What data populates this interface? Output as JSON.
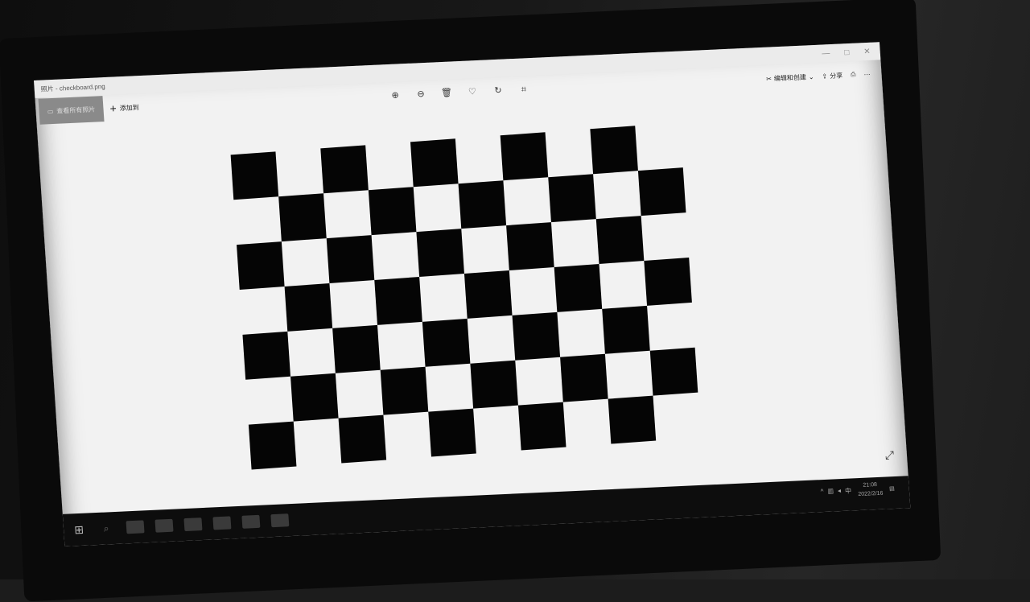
{
  "window": {
    "title": "照片 - checkboard.png"
  },
  "toolbar": {
    "album_label": "查看所有照片",
    "add_label": "添加到",
    "edit_label": "编辑和创建",
    "share_label": "分享",
    "center_tools": [
      "zoom-in-icon",
      "zoom-out-icon",
      "delete-icon",
      "heart-icon",
      "rotate-icon",
      "crop-icon"
    ]
  },
  "image": {
    "description_color_dark": "#050505",
    "rows": 7,
    "cols": 10
  },
  "taskbar": {
    "time": "21:08",
    "date": "2022/2/16"
  }
}
